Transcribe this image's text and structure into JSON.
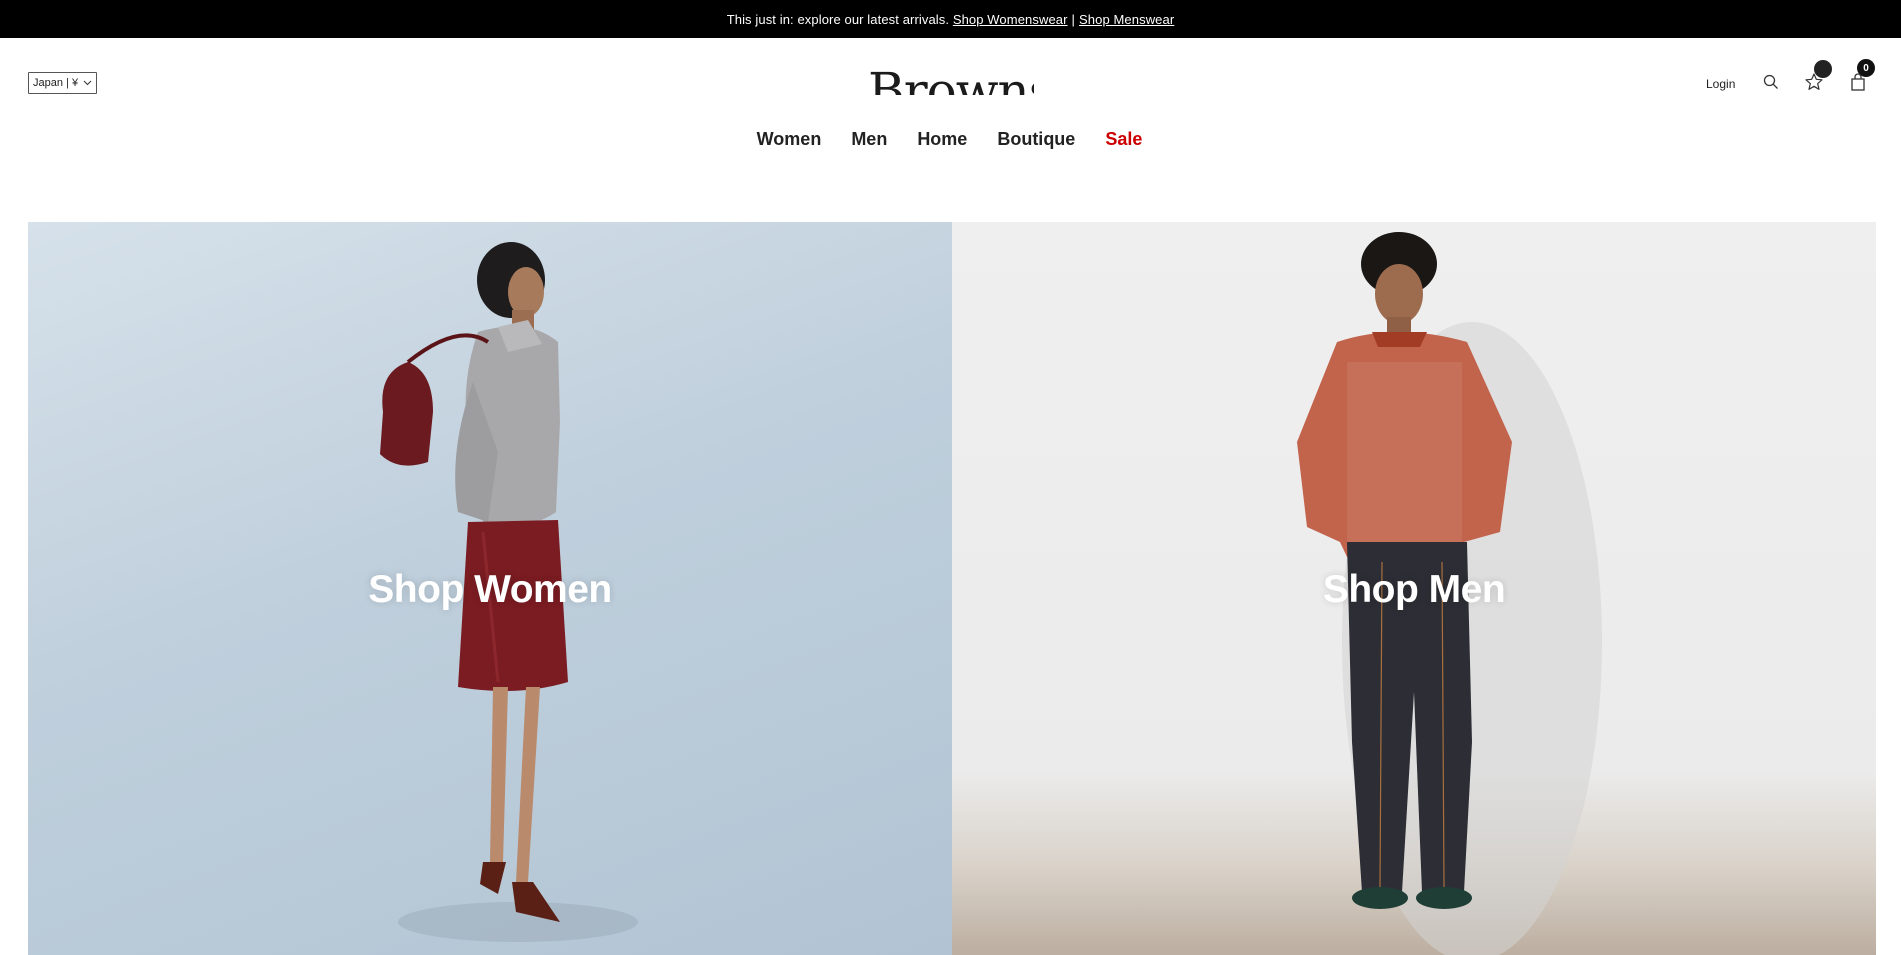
{
  "announcement": {
    "text": "This just in: explore our latest arrivals.",
    "link_women": "Shop Womenswear",
    "separator": "|",
    "link_men": "Shop Menswear"
  },
  "header": {
    "country_selector": "Japan | ¥",
    "logo": "Browns",
    "login": "Login",
    "bag_count": "0",
    "icons": [
      "search-icon",
      "star-icon",
      "bag-icon",
      "chevron-down-icon"
    ]
  },
  "nav": {
    "items": [
      {
        "label": "Women"
      },
      {
        "label": "Men"
      },
      {
        "label": "Home"
      },
      {
        "label": "Boutique"
      },
      {
        "label": "Sale"
      }
    ],
    "sale_color": "#cc0000"
  },
  "hero": {
    "women_label": "Shop Women",
    "men_label": "Shop Men"
  },
  "colors": {
    "announcement_bg": "#000000",
    "women_panel_bg": "#bfcfdc",
    "men_panel_bg": "#ececec"
  }
}
